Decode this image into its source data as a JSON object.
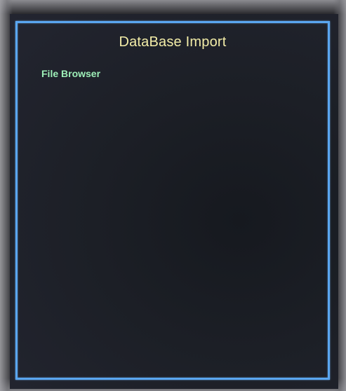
{
  "dialog": {
    "title": "DataBase Import",
    "items": [
      {
        "label": "File Browser"
      }
    ]
  },
  "colors": {
    "border": "#5aa6f0",
    "title": "#f3eda8",
    "item": "#9ef0b8",
    "background": "#1c1f26"
  }
}
